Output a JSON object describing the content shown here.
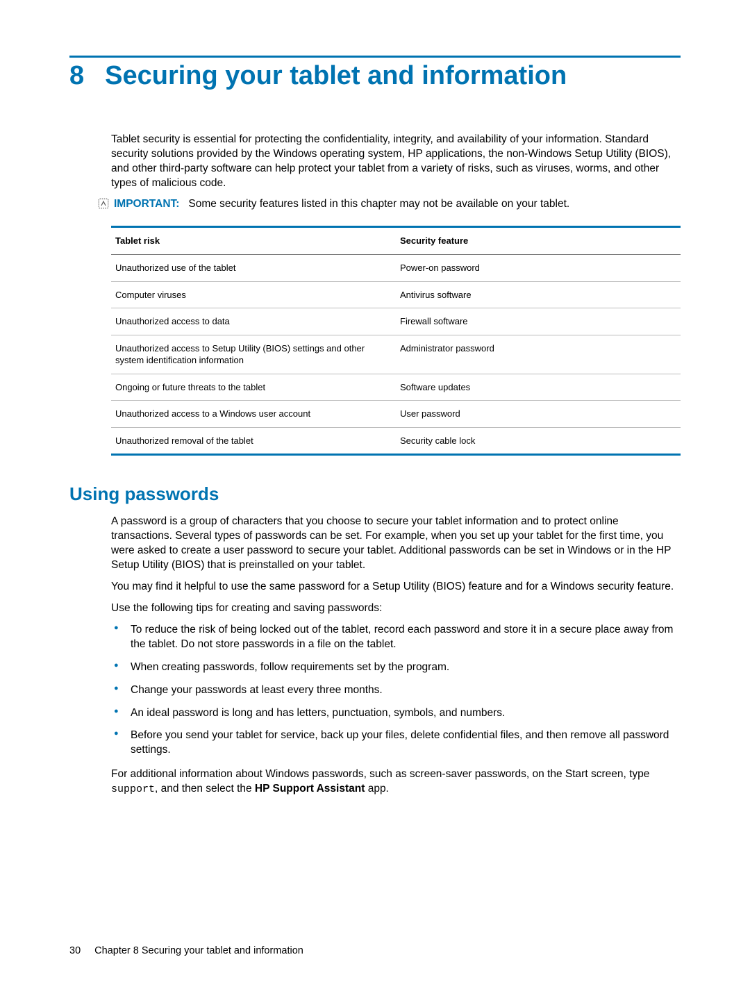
{
  "chapter": {
    "number": "8",
    "title": "Securing your tablet and information"
  },
  "intro": "Tablet security is essential for protecting the confidentiality, integrity, and availability of your information. Standard security solutions provided by the Windows operating system, HP applications, the non-Windows Setup Utility (BIOS), and other third-party software can help protect your tablet from a variety of risks, such as viruses, worms, and other types of malicious code.",
  "important": {
    "label": "IMPORTANT:",
    "text": "Some security features listed in this chapter may not be available on your tablet."
  },
  "table": {
    "headers": {
      "risk": "Tablet risk",
      "feature": "Security feature"
    },
    "rows": [
      {
        "risk": "Unauthorized use of the tablet",
        "feature": "Power-on password"
      },
      {
        "risk": "Computer viruses",
        "feature": "Antivirus software"
      },
      {
        "risk": "Unauthorized access to data",
        "feature": "Firewall software"
      },
      {
        "risk": "Unauthorized access to Setup Utility (BIOS) settings and other system identification information",
        "feature": "Administrator password"
      },
      {
        "risk": "Ongoing or future threats to the tablet",
        "feature": "Software updates"
      },
      {
        "risk": "Unauthorized access to a Windows user account",
        "feature": "User password"
      },
      {
        "risk": "Unauthorized removal of the tablet",
        "feature": "Security cable lock"
      }
    ]
  },
  "section": {
    "heading": "Using passwords",
    "p1": "A password is a group of characters that you choose to secure your tablet information and to protect online transactions. Several types of passwords can be set. For example, when you set up your tablet for the first time, you were asked to create a user password to secure your tablet. Additional passwords can be set in Windows or in the HP Setup Utility (BIOS) that is preinstalled on your tablet.",
    "p2": "You may find it helpful to use the same password for a Setup Utility (BIOS) feature and for a Windows security feature.",
    "p3": "Use the following tips for creating and saving passwords:",
    "tips": [
      "To reduce the risk of being locked out of the tablet, record each password and store it in a secure place away from the tablet. Do not store passwords in a file on the tablet.",
      "When creating passwords, follow requirements set by the program.",
      "Change your passwords at least every three months.",
      "An ideal password is long and has letters, punctuation, symbols, and numbers.",
      "Before you send your tablet for service, back up your files, delete confidential files, and then remove all password settings."
    ],
    "p4_pre": "For additional information about Windows passwords, such as screen-saver passwords, on the Start screen, type ",
    "p4_code": "support",
    "p4_mid": ", and then select the ",
    "p4_bold": "HP Support Assistant",
    "p4_post": " app."
  },
  "footer": {
    "page": "30",
    "text": "Chapter 8   Securing your tablet and information"
  }
}
